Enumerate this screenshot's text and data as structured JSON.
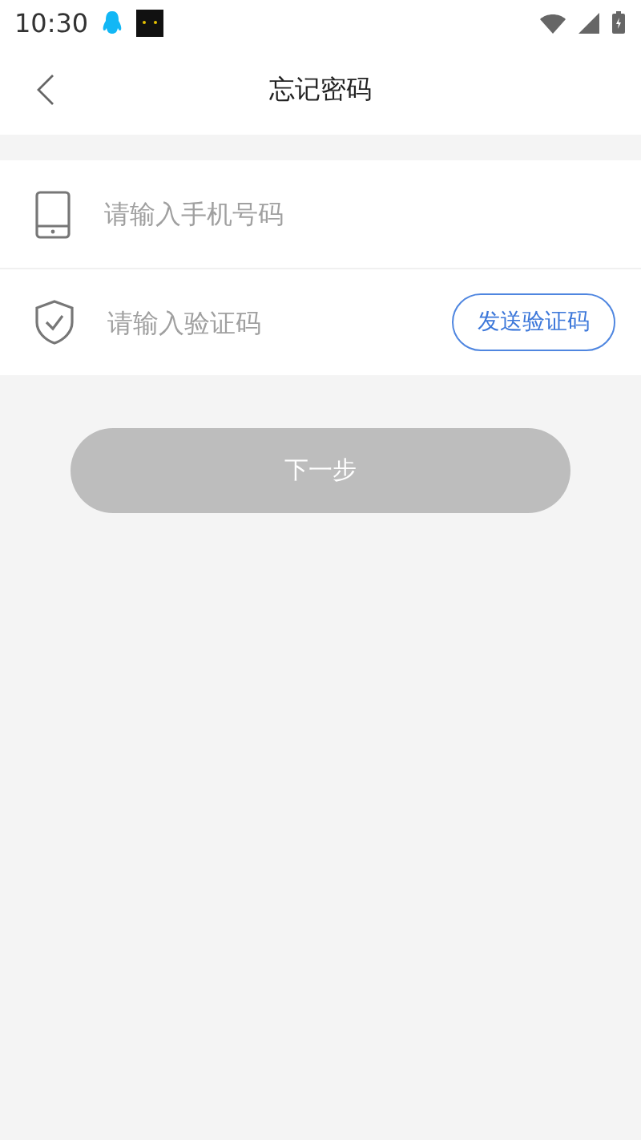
{
  "status_bar": {
    "time": "10:30"
  },
  "nav": {
    "title": "忘记密码"
  },
  "fields": [
    {
      "kind": "phone",
      "placeholder": "请输入手机号码"
    },
    {
      "kind": "code",
      "placeholder": "请输入验证码",
      "action": "发送验证码"
    }
  ],
  "next_button": {
    "label": "下一步",
    "disabled": true
  }
}
